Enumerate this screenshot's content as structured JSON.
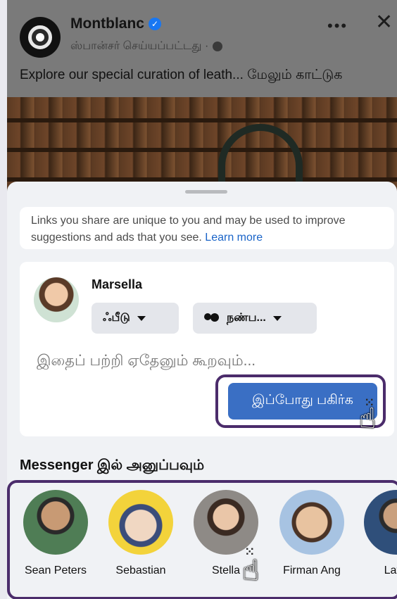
{
  "post": {
    "brand": "Montblanc",
    "sponsored": "ஸ்பான்சர் செய்யப்பட்டது ·",
    "caption": "Explore our special curation of leath... மேலும் காட்டுக",
    "more_label": "•••",
    "close_label": "✕"
  },
  "sheet": {
    "notice_text": "Links you share are unique to you and may be used to improve suggestions and ads that you see.",
    "learn_more": "Learn more"
  },
  "composer": {
    "username": "Marsella",
    "destination_chip": "ஃபீடு",
    "audience_chip": "நண்ப...",
    "placeholder": "இதைப் பற்றி ஏதேனும் கூறவும்...",
    "share_button": "இப்போது பகிர்க"
  },
  "messenger": {
    "title": "Messenger இல் அனுப்பவும்",
    "contacts": [
      {
        "name": "Sean Peters",
        "color": "#4f7d55"
      },
      {
        "name": "Sebastian",
        "color": "#f3d33b"
      },
      {
        "name": "Stella",
        "color": "#8e8a86"
      },
      {
        "name": "Firman Ang",
        "color": "#a7c3e2"
      },
      {
        "name": "Lave",
        "color": "#d8dde4"
      }
    ]
  },
  "colors": {
    "accent": "#3a6fc4",
    "highlight_border": "#4b2c6b",
    "link": "#1a64c8"
  }
}
